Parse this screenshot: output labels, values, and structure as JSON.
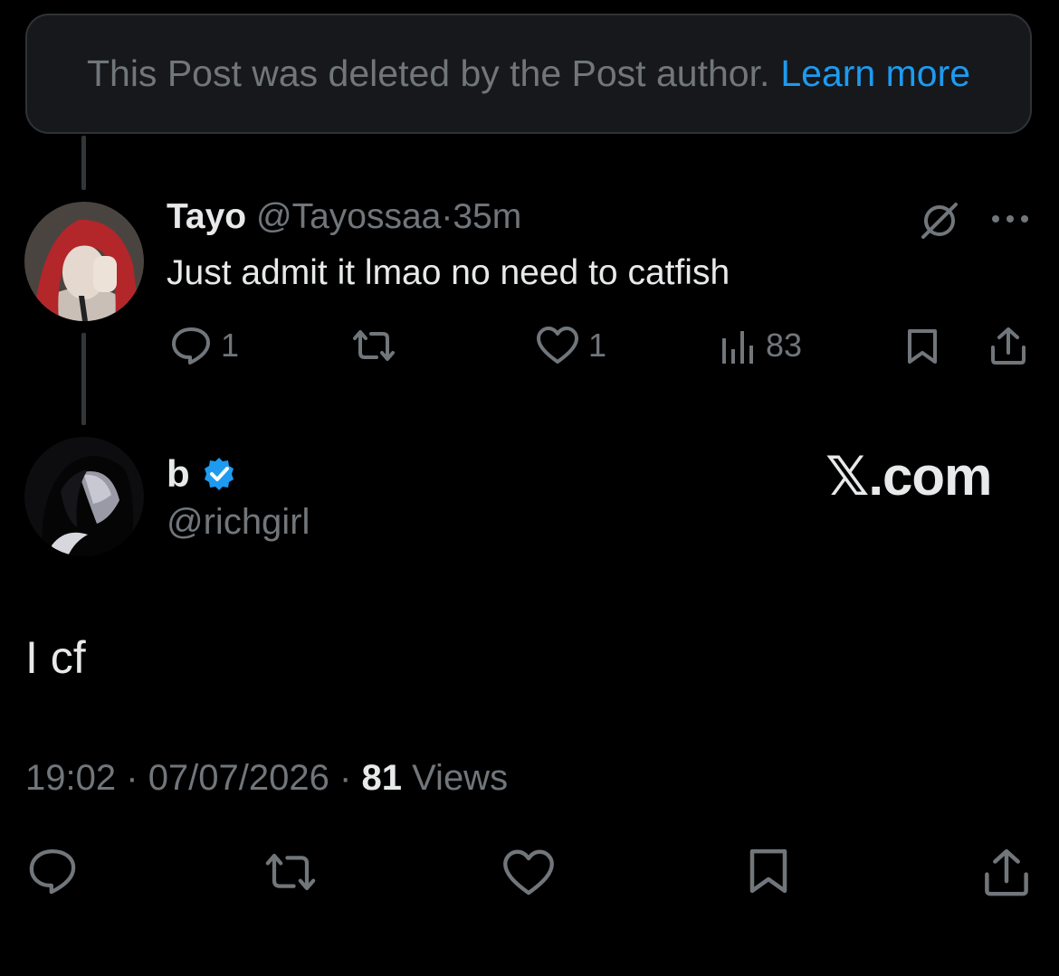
{
  "deleted_notice": {
    "text": "This Post was deleted by the Post author.",
    "link": "Learn more"
  },
  "reply": {
    "name": "Tayo",
    "handle": "@Tayossaa",
    "separator": "·",
    "time": "35m",
    "text": "Just admit it lmao no need to catfish",
    "reply_count": "1",
    "like_count": "1",
    "view_count": "83",
    "icons": [
      "grok-icon",
      "more-icon",
      "reply-icon",
      "repost-icon",
      "like-icon",
      "views-icon",
      "bookmark-icon",
      "share-icon"
    ]
  },
  "main_post": {
    "name": "b",
    "verified": true,
    "handle": "@richgirl",
    "watermark": "𝕏.com",
    "text": "I cf",
    "time": "19:02",
    "date": "07/07/2026",
    "separator": "·",
    "views_count": "81",
    "views_label": "Views"
  },
  "colors": {
    "background": "#000000",
    "text": "#e7e9ea",
    "muted": "#71767b",
    "accent": "#1d9bf0"
  }
}
